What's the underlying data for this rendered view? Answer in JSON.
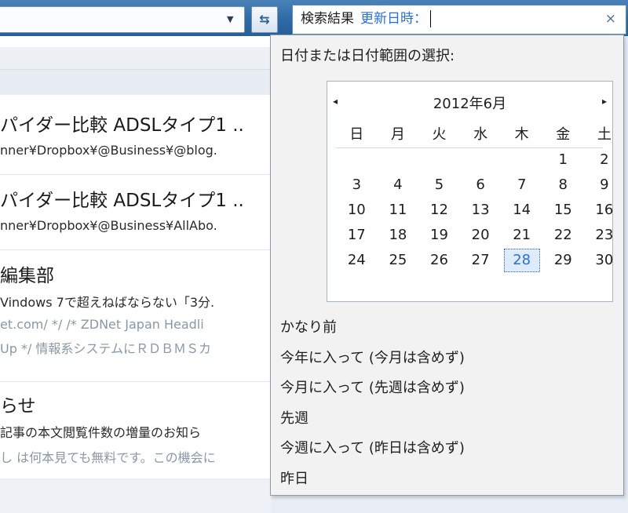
{
  "search": {
    "keyword": "検索結果",
    "filter_label": "更新日時：",
    "close_glyph": "×"
  },
  "toolbar": {
    "refresh_glyph": "⇆",
    "dropdown_glyph": "▼"
  },
  "results": {
    "items": [
      {
        "title": "パイダー比較 ADSLタイプ1 ..",
        "path": "nner¥Dropbox¥@Business¥@blog."
      },
      {
        "title": "パイダー比較 ADSLタイプ1 ..",
        "path": "nner¥Dropbox¥@Business¥AllAbo."
      },
      {
        "title": "編集部",
        "sub": "Vindows 7で超えねばならない「3分.",
        "snip1": "et.com/ */ /* ZDNet Japan Headli",
        "snip2": "Up */ 情報系システムにＲＤＢＭＳカ"
      },
      {
        "title": "らせ",
        "sub": "記事の本文閲覧件数の増量のお知ら",
        "snip1": "し は何本見ても無料です。この機会に"
      }
    ]
  },
  "date_picker": {
    "heading": "日付または日付範囲の選択:",
    "calendar": {
      "month_label": "2012年6月",
      "prev_glyph": "◂",
      "next_glyph": "▸",
      "weekdays": [
        "日",
        "月",
        "火",
        "水",
        "木",
        "金",
        "土"
      ],
      "weeks": [
        [
          "",
          "",
          "",
          "",
          "",
          "1",
          "2"
        ],
        [
          "3",
          "4",
          "5",
          "6",
          "7",
          "8",
          "9"
        ],
        [
          "10",
          "11",
          "12",
          "13",
          "14",
          "15",
          "16"
        ],
        [
          "17",
          "18",
          "19",
          "20",
          "21",
          "22",
          "23"
        ],
        [
          "24",
          "25",
          "26",
          "27",
          "28",
          "29",
          "30"
        ]
      ],
      "selected_day": "28"
    },
    "presets": [
      "かなり前",
      "今年に入って (今月は含めず)",
      "今月に入って (先週は含めず)",
      "先週",
      "今週に入って (昨日は含めず)",
      "昨日"
    ]
  },
  "colors": {
    "accent": "#2a6fd6",
    "toolbar": "#2d6aa6",
    "selected_bg": "#ddebfb"
  }
}
